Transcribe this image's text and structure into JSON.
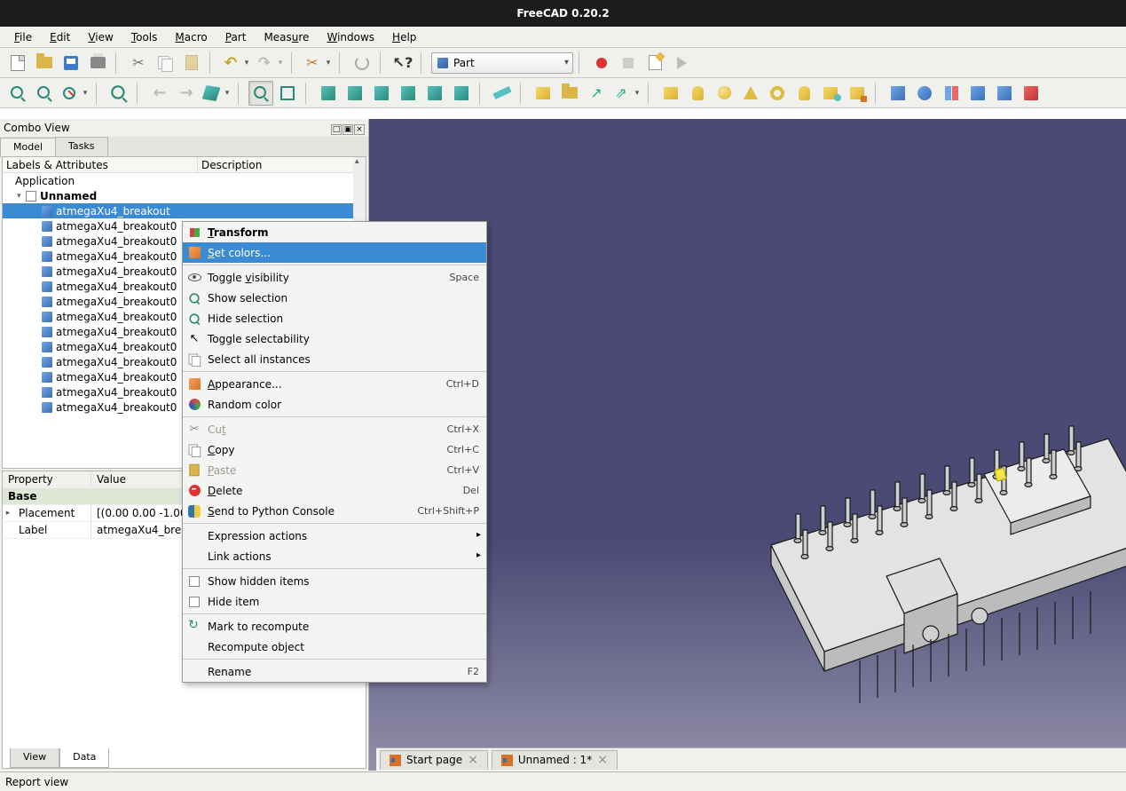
{
  "title": "FreeCAD 0.20.2",
  "menubar": [
    "File",
    "Edit",
    "View",
    "Tools",
    "Macro",
    "Part",
    "Measure",
    "Windows",
    "Help"
  ],
  "workbench_selector": "Part",
  "combo": {
    "title": "Combo View",
    "tabs": [
      "Model",
      "Tasks"
    ],
    "active_tab": 0,
    "tree_headers": [
      "Labels & Attributes",
      "Description"
    ],
    "tree": {
      "root": "Application",
      "doc": "Unnamed",
      "items": [
        "atmegaXu4_breakout",
        "atmegaXu4_breakout0",
        "atmegaXu4_breakout0",
        "atmegaXu4_breakout0",
        "atmegaXu4_breakout0",
        "atmegaXu4_breakout0",
        "atmegaXu4_breakout0",
        "atmegaXu4_breakout0",
        "atmegaXu4_breakout0",
        "atmegaXu4_breakout0",
        "atmegaXu4_breakout0",
        "atmegaXu4_breakout0",
        "atmegaXu4_breakout0",
        "atmegaXu4_breakout0"
      ],
      "selected_index": 0
    },
    "props": {
      "headers": [
        "Property",
        "Value"
      ],
      "group": "Base",
      "rows": [
        {
          "name": "Placement",
          "value": "[(0.00 0.00 -1.00"
        },
        {
          "name": "Label",
          "value": "atmegaXu4_brea"
        }
      ],
      "tabs": [
        "View",
        "Data"
      ],
      "active_tab": 1
    }
  },
  "doctabs": [
    {
      "label": "Start page"
    },
    {
      "label": "Unnamed : 1*"
    }
  ],
  "reportview": "Report view",
  "ctx": [
    {
      "type": "item",
      "icon": "transform",
      "label": "Transform",
      "bold": true
    },
    {
      "type": "item",
      "icon": "cube",
      "label": "Set colors...",
      "hl": true
    },
    {
      "type": "sep"
    },
    {
      "type": "item",
      "icon": "eye",
      "label": "Toggle visibility",
      "accel": "Space"
    },
    {
      "type": "item",
      "icon": "mag",
      "label": "Show selection"
    },
    {
      "type": "item",
      "icon": "mag",
      "label": "Hide selection"
    },
    {
      "type": "item",
      "icon": "pointer",
      "label": "Toggle selectability"
    },
    {
      "type": "item",
      "icon": "copy",
      "label": "Select all instances"
    },
    {
      "type": "sep"
    },
    {
      "type": "item",
      "icon": "cube",
      "label": "Appearance...",
      "accel": "Ctrl+D"
    },
    {
      "type": "item",
      "icon": "rand",
      "label": "Random color"
    },
    {
      "type": "sep"
    },
    {
      "type": "item",
      "icon": "scissors",
      "label": "Cut",
      "accel": "Ctrl+X",
      "disabled": true
    },
    {
      "type": "item",
      "icon": "copy",
      "label": "Copy",
      "accel": "Ctrl+C"
    },
    {
      "type": "item",
      "icon": "paste",
      "label": "Paste",
      "accel": "Ctrl+V",
      "disabled": true
    },
    {
      "type": "item",
      "icon": "delete",
      "label": "Delete",
      "accel": "Del"
    },
    {
      "type": "item",
      "icon": "python",
      "label": "Send to Python Console",
      "accel": "Ctrl+Shift+P"
    },
    {
      "type": "sep"
    },
    {
      "type": "item",
      "label": "Expression actions",
      "submenu": true
    },
    {
      "type": "item",
      "label": "Link actions",
      "submenu": true
    },
    {
      "type": "sep"
    },
    {
      "type": "item",
      "icon": "check",
      "label": "Show hidden items"
    },
    {
      "type": "item",
      "icon": "check",
      "label": "Hide item"
    },
    {
      "type": "sep"
    },
    {
      "type": "item",
      "icon": "recompute",
      "label": "Mark to recompute"
    },
    {
      "type": "item",
      "label": "Recompute object"
    },
    {
      "type": "sep"
    },
    {
      "type": "item",
      "label": "Rename",
      "accel": "F2"
    }
  ]
}
